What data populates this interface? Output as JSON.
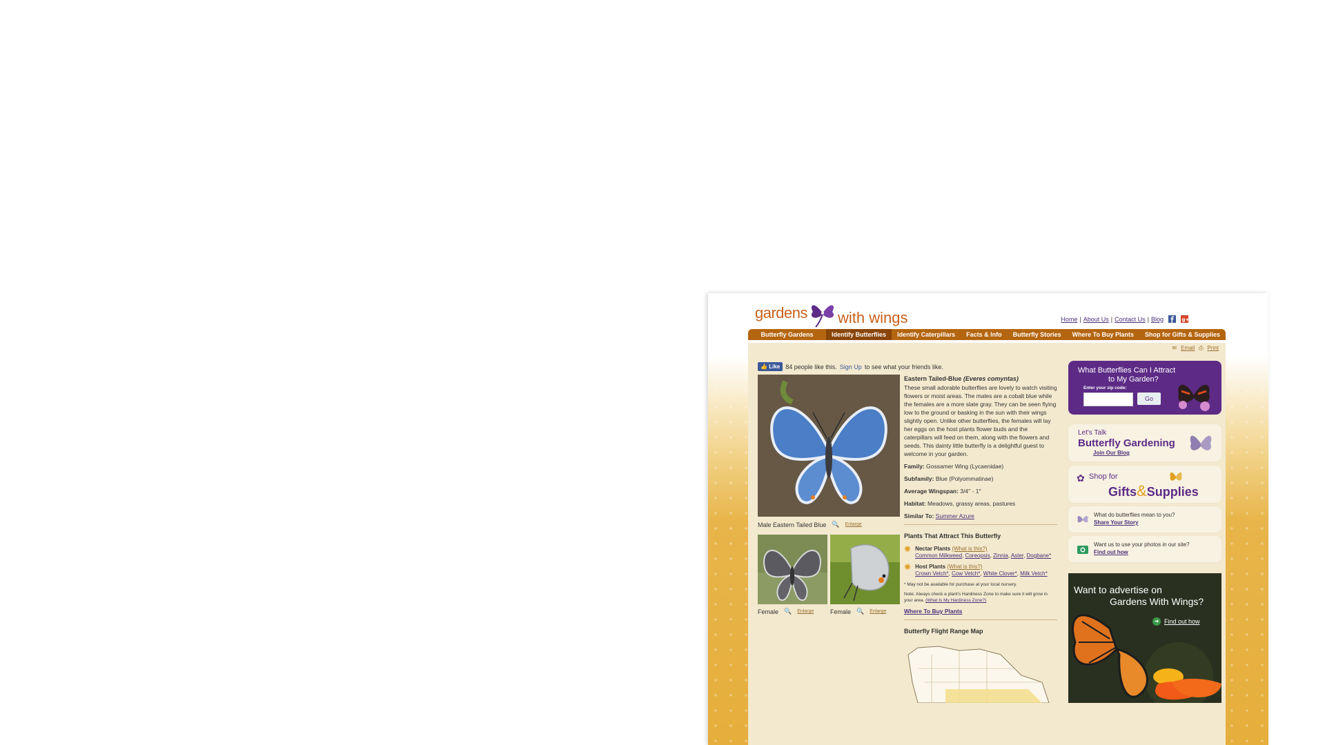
{
  "site": {
    "logo_top": "gardens",
    "logo_bottom": "with wings",
    "top_links": [
      "Home",
      "About Us",
      "Contact Us",
      "Blog"
    ]
  },
  "nav": {
    "items": [
      "Butterfly Gardens",
      "Identify Butterflies",
      "Identify Caterpillars",
      "Facts & Info",
      "Butterfly Stories",
      "Where To Buy Plants",
      "Shop for Gifts & Supplies"
    ],
    "active_index": 1
  },
  "utility": {
    "email": "Email",
    "print": "Print"
  },
  "facebook": {
    "like": "Like",
    "count_text": "84 people like this.",
    "signup": "Sign Up",
    "suffix": "to see what your friends like."
  },
  "photos": {
    "main_caption": "Male Eastern Tailed Blue",
    "enlarge": "Enlarge",
    "female1_caption": "Female",
    "female2_caption": "Female"
  },
  "butterfly": {
    "name": "Eastern Tailed-Blue",
    "latin": "(Everes comyntas)",
    "description": "These small adorable butterflies are lovely to watch visiting flowers or moist areas. The males are a cobalt blue while the females are a more slate gray. They can be seen flying low to the ground or basking in the sun with their wings slightly open. Unlike other butterflies, the females will lay her eggs on the host plants flower buds and the caterpillars will feed on them, along with the flowers and seeds. This dainty little butterfly is a delightful guest to welcome in your garden.",
    "family_label": "Family:",
    "family": "Gossamer Wing (Lycaenidae)",
    "subfamily_label": "Subfamily:",
    "subfamily": "Blue (Polyommatinae)",
    "wingspan_label": "Average Wingspan:",
    "wingspan": "3/4\" - 1\"",
    "habitat_label": "Habitat:",
    "habitat": "Meadows, grassy areas, pastures",
    "similar_label": "Similar To:",
    "similar": "Summer Azure"
  },
  "plants": {
    "title": "Plants That Attract This Butterfly",
    "nectar_label": "Nectar Plants",
    "host_label": "Host Plants",
    "what_is_this": "(What is this?)",
    "nectar_list": [
      "Common Milkweed",
      "Coreopsis",
      "Zinnia",
      "Aster",
      "Dogbane*"
    ],
    "host_list": [
      "Crown Vetch*",
      "Cow Vetch*",
      "White Clover*",
      "Milk Vetch*"
    ],
    "note1": "* May not be available for purchase at your local nursery.",
    "note2": "Note: Always check a plant's Hardiness Zone to make sure it will grow in your area.",
    "note2_link": "(What Is My Hardiness Zone?)",
    "where_to_buy": "Where To Buy Plants"
  },
  "map": {
    "title": "Butterfly Flight Range Map"
  },
  "sidebar": {
    "attract_line1": "What Butterflies Can I Attract",
    "attract_line2": "to My Garden?",
    "zip_label": "Enter your zip code:",
    "go": "Go",
    "lets_talk": "Let's Talk",
    "butterfly_gardening": "Butterfly Gardening",
    "join_blog": "Join Our Blog",
    "shop_for": "Shop for",
    "gifts": "Gifts",
    "amp": "&",
    "supplies": "Supplies",
    "story_q": "What do butterflies mean to you?",
    "story_link": "Share Your Story",
    "photos_q": "Want us to use your photos in our site?",
    "photos_link": "Find out how",
    "ad_line1": "Want to advertise on",
    "ad_line2": "Gardens With Wings?",
    "ad_link": "Find out how"
  },
  "colors": {
    "purple": "#5d2b86",
    "nav_brown": "#b4650f",
    "logo_orange": "#c8601b",
    "link_purple": "#4a2f7a"
  }
}
